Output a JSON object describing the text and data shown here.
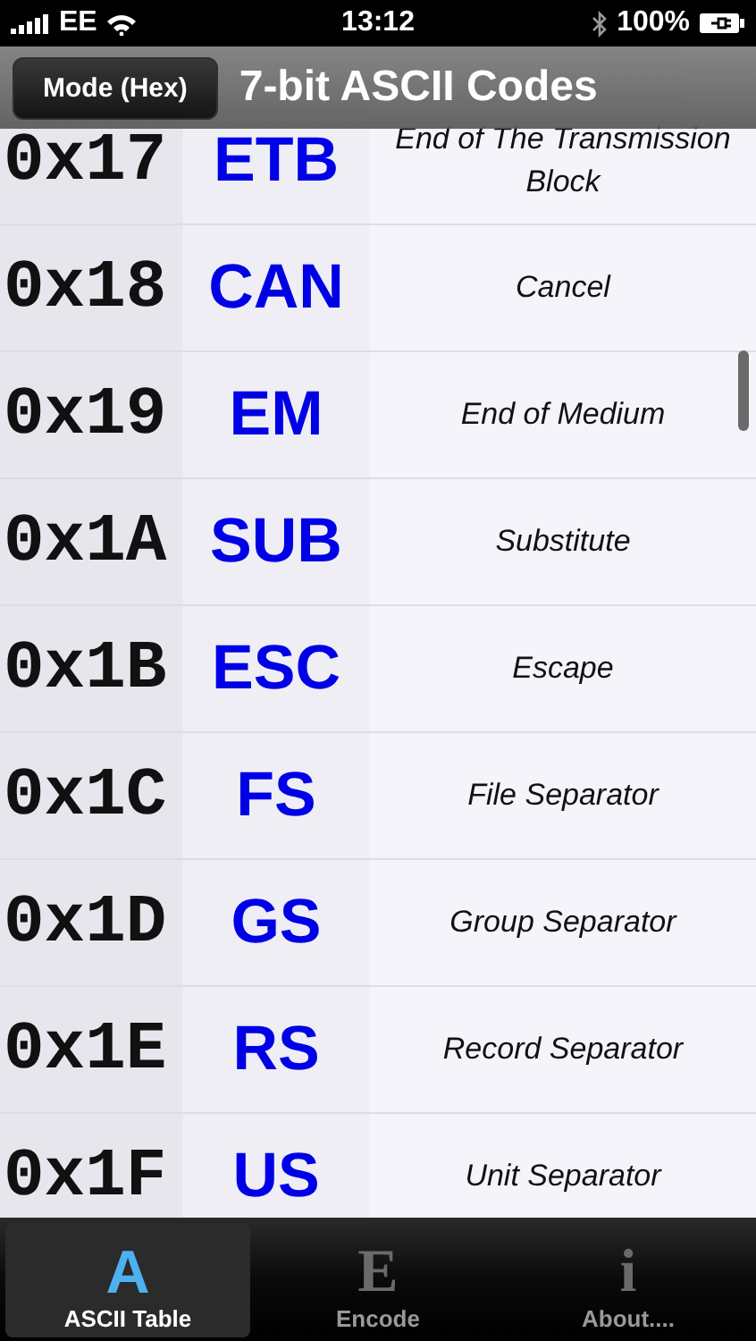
{
  "status_bar": {
    "carrier": "EE",
    "time": "13:12",
    "battery": "100%"
  },
  "nav_bar": {
    "button": "Mode (Hex)",
    "title": "7-bit ASCII Codes"
  },
  "rows": [
    {
      "code": "0x17",
      "mnemonic": "ETB",
      "description": "End of The Transmission Block"
    },
    {
      "code": "0x18",
      "mnemonic": "CAN",
      "description": "Cancel"
    },
    {
      "code": "0x19",
      "mnemonic": "EM",
      "description": "End of Medium"
    },
    {
      "code": "0x1A",
      "mnemonic": "SUB",
      "description": "Substitute"
    },
    {
      "code": "0x1B",
      "mnemonic": "ESC",
      "description": "Escape"
    },
    {
      "code": "0x1C",
      "mnemonic": "FS",
      "description": "File Separator"
    },
    {
      "code": "0x1D",
      "mnemonic": "GS",
      "description": "Group Separator"
    },
    {
      "code": "0x1E",
      "mnemonic": "RS",
      "description": "Record Separator"
    },
    {
      "code": "0x1F",
      "mnemonic": "US",
      "description": "Unit Separator"
    }
  ],
  "tabs": [
    {
      "glyph": "A",
      "label": "ASCII Table",
      "selected": true
    },
    {
      "glyph": "E",
      "label": "Encode",
      "selected": false
    },
    {
      "glyph": "i",
      "label": "About....",
      "selected": false
    }
  ]
}
